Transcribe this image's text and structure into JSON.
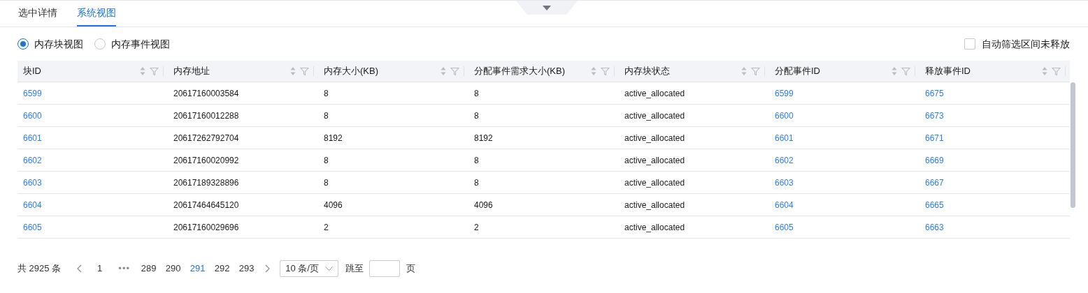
{
  "tabs": [
    {
      "label": "选中详情",
      "selected": false
    },
    {
      "label": "系统视图",
      "selected": true
    }
  ],
  "view_options": [
    {
      "label": "内存块视图",
      "selected": true
    },
    {
      "label": "内存事件视图",
      "selected": false
    }
  ],
  "auto_filter": {
    "label": "自动筛选区间未释放",
    "checked": false
  },
  "table": {
    "columns": [
      {
        "label": "块ID",
        "kind": "link"
      },
      {
        "label": "内存地址",
        "kind": "text"
      },
      {
        "label": "内存大小(KB)",
        "kind": "text"
      },
      {
        "label": "分配事件需求大小(KB)",
        "kind": "text"
      },
      {
        "label": "内存块状态",
        "kind": "text"
      },
      {
        "label": "分配事件ID",
        "kind": "link"
      },
      {
        "label": "释放事件ID",
        "kind": "link"
      }
    ],
    "rows": [
      [
        "6599",
        "20617160003584",
        "8",
        "8",
        "active_allocated",
        "6599",
        "6675"
      ],
      [
        "6600",
        "20617160012288",
        "8",
        "8",
        "active_allocated",
        "6600",
        "6673"
      ],
      [
        "6601",
        "20617262792704",
        "8192",
        "8192",
        "active_allocated",
        "6601",
        "6671"
      ],
      [
        "6602",
        "20617160020992",
        "8",
        "8",
        "active_allocated",
        "6602",
        "6669"
      ],
      [
        "6603",
        "20617189328896",
        "8",
        "8",
        "active_allocated",
        "6603",
        "6667"
      ],
      [
        "6604",
        "20617464645120",
        "4096",
        "4096",
        "active_allocated",
        "6604",
        "6665"
      ],
      [
        "6605",
        "20617160029696",
        "2",
        "2",
        "active_allocated",
        "6605",
        "6663"
      ]
    ]
  },
  "pagination": {
    "total": "共 2925 条",
    "items": [
      {
        "kind": "prev",
        "selected": false
      },
      {
        "kind": "page",
        "label": "1",
        "selected": false
      },
      {
        "kind": "ellipsis",
        "label": "•••",
        "selected": false
      },
      {
        "kind": "page",
        "label": "289",
        "selected": false
      },
      {
        "kind": "page",
        "label": "290",
        "selected": false
      },
      {
        "kind": "page",
        "label": "291",
        "selected": true
      },
      {
        "kind": "page",
        "label": "292",
        "selected": false
      },
      {
        "kind": "page",
        "label": "293",
        "selected": false
      },
      {
        "kind": "next",
        "selected": false
      }
    ],
    "page_size": "10 条/页",
    "jump_label": "跳至",
    "page_unit": "页"
  }
}
